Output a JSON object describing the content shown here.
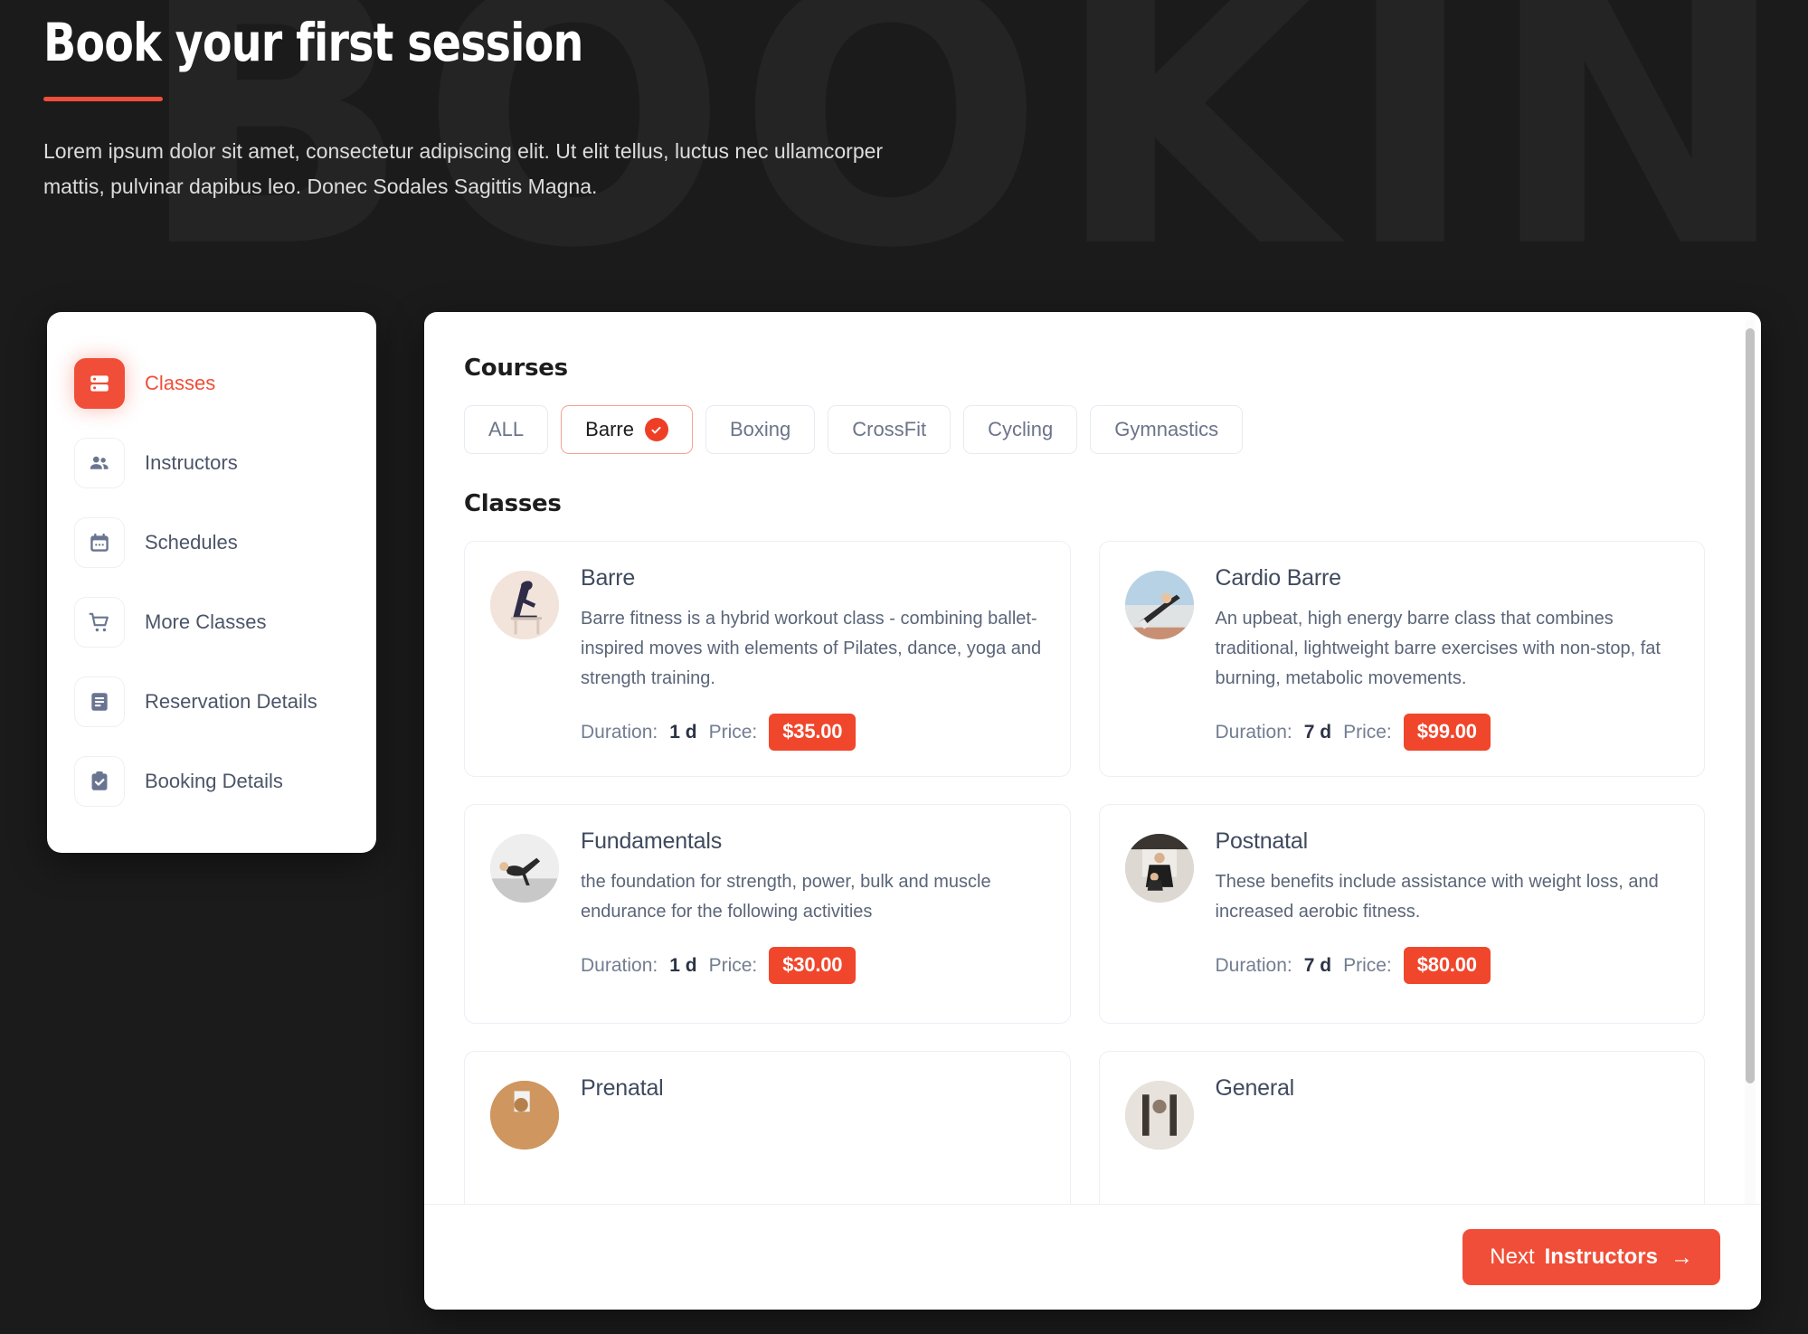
{
  "background": {
    "watermark_text": "BOOKING",
    "page_bg": "#1b1b1b",
    "watermark_color": "#242424"
  },
  "hero": {
    "title": "Book your first session",
    "subtitle": "Lorem ipsum dolor sit amet, consectetur adipiscing elit. Ut elit tellus, luctus nec ullamcorper mattis, pulvinar dapibus leo. Donec Sodales Sagittis Magna.",
    "accent_color": "#f04e38"
  },
  "sidebar": {
    "items": [
      {
        "label": "Classes",
        "icon": "server-icon",
        "active": true
      },
      {
        "label": "Instructors",
        "icon": "people-icon",
        "active": false
      },
      {
        "label": "Schedules",
        "icon": "calendar-icon",
        "active": false
      },
      {
        "label": "More Classes",
        "icon": "cart-icon",
        "active": false
      },
      {
        "label": "Reservation Details",
        "icon": "document-icon",
        "active": false
      },
      {
        "label": "Booking Details",
        "icon": "clipboard-check-icon",
        "active": false
      }
    ]
  },
  "main": {
    "courses_heading": "Courses",
    "classes_heading": "Classes",
    "filters": [
      {
        "label": "ALL",
        "selected": false
      },
      {
        "label": "Barre",
        "selected": true
      },
      {
        "label": "Boxing",
        "selected": false
      },
      {
        "label": "CrossFit",
        "selected": false
      },
      {
        "label": "Cycling",
        "selected": false
      },
      {
        "label": "Gymnastics",
        "selected": false
      }
    ],
    "duration_label": "Duration:",
    "price_label": "Price:",
    "classes": [
      {
        "title": "Barre",
        "description": "Barre fitness is a hybrid workout class - combining ballet-inspired moves with elements of Pilates, dance, yoga and strength training.",
        "duration": "1 d",
        "price": "$35.00",
        "thumb": "barre-photo"
      },
      {
        "title": "Cardio Barre",
        "description": "An upbeat, high energy barre class that combines traditional, lightweight barre exercises with non-stop, fat burning, metabolic movements.",
        "duration": "7 d",
        "price": "$99.00",
        "thumb": "cardio-barre-photo"
      },
      {
        "title": "Fundamentals",
        "description": "the foundation for strength, power, bulk and muscle endurance for the following activities",
        "duration": "1 d",
        "price": "$30.00",
        "thumb": "fundamentals-photo"
      },
      {
        "title": "Postnatal",
        "description": "These benefits include assistance with weight loss, and increased aerobic fitness.",
        "duration": "7 d",
        "price": "$80.00",
        "thumb": "postnatal-photo"
      },
      {
        "title": "Prenatal",
        "description": "",
        "duration": "",
        "price": "",
        "thumb": "prenatal-photo"
      },
      {
        "title": "General",
        "description": "",
        "duration": "",
        "price": "",
        "thumb": "general-photo"
      }
    ]
  },
  "footer": {
    "next_button_light": "Next",
    "next_button_bold": "Instructors",
    "next_button_arrow": "→",
    "next_button_color": "#f04e38"
  }
}
